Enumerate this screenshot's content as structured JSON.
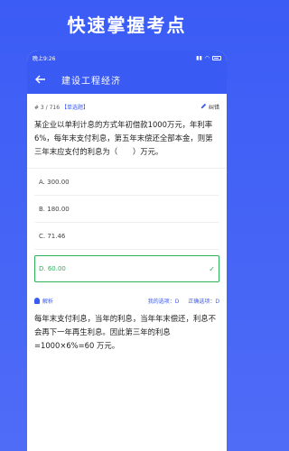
{
  "promo": {
    "headline": "快速掌握考点"
  },
  "status_bar": {
    "time": "晚上9:26"
  },
  "app_bar": {
    "title": "建设工程经济"
  },
  "question": {
    "index": "# 3 / 716",
    "type": "【单选题】",
    "edit_label": "纠错",
    "text": "某企业以单利计息的方式年初借款1000万元，年利率6%，每年末支付利息，第五年末偿还全部本金，则第三年末应支付的利息为（　　）万元。"
  },
  "options": [
    {
      "label": "A. 300.00",
      "correct": false
    },
    {
      "label": "B. 180.00",
      "correct": false
    },
    {
      "label": "C. 71.46",
      "correct": false
    },
    {
      "label": "D. 60.00",
      "correct": true
    }
  ],
  "answer": {
    "analysis_label": "解析",
    "my_answer": "我的选项：D",
    "correct_answer": "正确选项：D",
    "analysis_text": "每年末支付利息，当年的利息，当年年末偿还，利息不会再下一年再生利息。因此第三年的利息=1000×6%=60 万元。"
  },
  "colors": {
    "brand": "#3a5af4",
    "correct": "#2fb15a"
  }
}
